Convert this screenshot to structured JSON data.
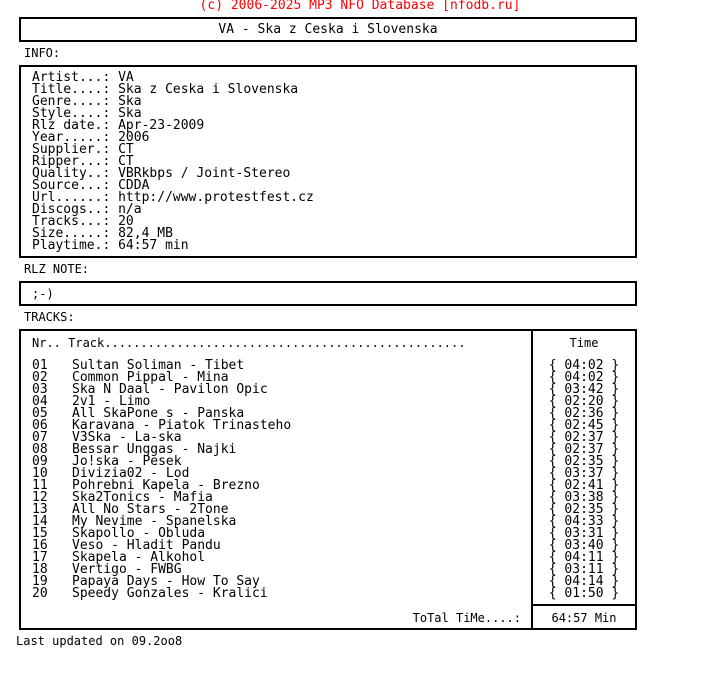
{
  "copyright": "(c) 2006-2025 MP3 NFO Database [nfodb.ru]",
  "title": "VA - Ska z Ceska i Slovenska",
  "info_label": "INFO:",
  "info": [
    {
      "key": "Artist...:",
      "value": "VA"
    },
    {
      "key": "Title....:",
      "value": "Ska z Ceska i Slovenska"
    },
    {
      "key": "Genre....:",
      "value": "Ska"
    },
    {
      "key": "Style....:",
      "value": "Ska"
    },
    {
      "key": "Rlz date.:",
      "value": "Apr-23-2009"
    },
    {
      "key": "Year.....:",
      "value": "2006"
    },
    {
      "key": "Supplier.:",
      "value": "CT"
    },
    {
      "key": "Ripper...:",
      "value": "CT"
    },
    {
      "key": "Quality..:",
      "value": "VBRkbps / Joint-Stereo"
    },
    {
      "key": "Source...:",
      "value": "CDDA"
    },
    {
      "key": "Url......:",
      "value": "http://www.protestfest.cz"
    },
    {
      "key": "Discogs..:",
      "value": "n/a"
    },
    {
      "key": "Tracks...:",
      "value": "20"
    },
    {
      "key": "Size.....:",
      "value": "82,4 MB"
    },
    {
      "key": "Playtime.:",
      "value": "64:57 min"
    }
  ],
  "note_label": "RLZ NOTE:",
  "note": ";-)",
  "tracks_label": "TRACKS:",
  "tracks_header": "Nr.. Track..................................................",
  "time_header": "Time",
  "tracks": [
    {
      "nr": "01",
      "name": "Sultan Soliman - Tibet",
      "time": "{ 04:02 }"
    },
    {
      "nr": "02",
      "name": "Common Pippal - Mina",
      "time": "{ 04:02 }"
    },
    {
      "nr": "03",
      "name": "Ska N Daal - Pavilon Opic",
      "time": "{ 03:42 }"
    },
    {
      "nr": "04",
      "name": "2v1 - Limo",
      "time": "{ 02:20 }"
    },
    {
      "nr": "05",
      "name": "All SkaPone s - Panska",
      "time": "{ 02:36 }"
    },
    {
      "nr": "06",
      "name": "Karavana - Piatok Trinasteho",
      "time": "{ 02:45 }"
    },
    {
      "nr": "07",
      "name": "V3Ska - La-ska",
      "time": "{ 02:37 }"
    },
    {
      "nr": "08",
      "name": "Bessar Unggas - Najki",
      "time": "{ 02:37 }"
    },
    {
      "nr": "09",
      "name": "Jo!ska - Pesek",
      "time": "{ 02:35 }"
    },
    {
      "nr": "10",
      "name": "Divizia02 - Lod",
      "time": "{ 03:37 }"
    },
    {
      "nr": "11",
      "name": "Pohrebni Kapela - Brezno",
      "time": "{ 02:41 }"
    },
    {
      "nr": "12",
      "name": "Ska2Tonics - Mafia",
      "time": "{ 03:38 }"
    },
    {
      "nr": "13",
      "name": "All No Stars - 2Tone",
      "time": "{ 02:35 }"
    },
    {
      "nr": "14",
      "name": "My Nevime - Spanelska",
      "time": "{ 04:33 }"
    },
    {
      "nr": "15",
      "name": "Skapollo - Obluda",
      "time": "{ 03:31 }"
    },
    {
      "nr": "16",
      "name": "Veso - Hladit Pandu",
      "time": "{ 03:40 }"
    },
    {
      "nr": "17",
      "name": "Skapela - Alkohol",
      "time": "{ 04:11 }"
    },
    {
      "nr": "18",
      "name": "Vertigo - FWBG",
      "time": "{ 03:11 }"
    },
    {
      "nr": "19",
      "name": "Papaya Days - How To Say",
      "time": "{ 04:14 }"
    },
    {
      "nr": "20",
      "name": "Speedy Gonzales - Kralici",
      "time": "{ 01:50 }"
    }
  ],
  "total_label": "ToTal TiMe....:",
  "total_value": "64:57 Min",
  "updated": "Last updated on 09.2oo8",
  "colors": {
    "copyright": "#ff0000",
    "border": "#000000",
    "text": "#000000"
  }
}
